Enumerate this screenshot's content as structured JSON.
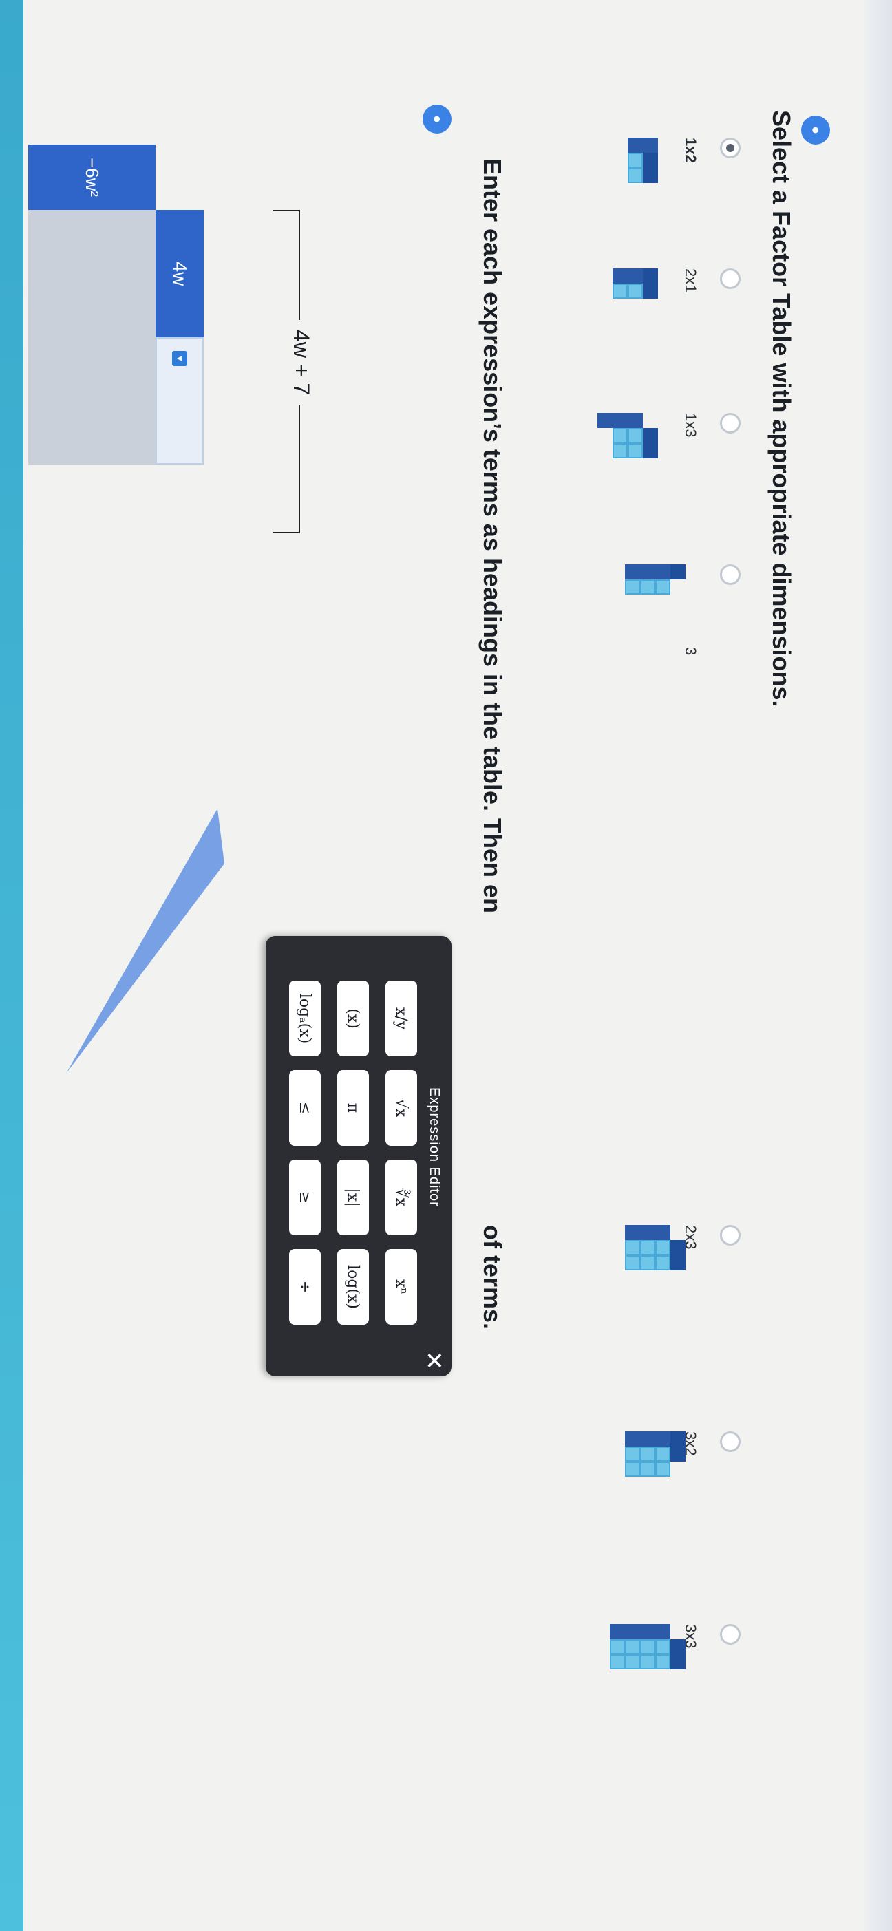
{
  "q1": {
    "number": "●",
    "title": "Select a Factor Table with appropriate dimensions.",
    "options": [
      {
        "label": "1x2",
        "selected": true
      },
      {
        "label": "2x1",
        "selected": false
      },
      {
        "label": "1x3",
        "selected": false
      },
      {
        "label": "3",
        "selected": false
      },
      {
        "label": "2x3",
        "selected": false
      },
      {
        "label": "3x2",
        "selected": false
      },
      {
        "label": "3x3",
        "selected": false
      }
    ]
  },
  "q2": {
    "number": "●",
    "title": "Enter each expression’s terms as headings in the table. Then en",
    "title_tail": "of terms.",
    "table": {
      "col_headers": [
        "4w",
        ""
      ],
      "row_headers": [
        "−6w²"
      ]
    },
    "expression_label": "4w + 7"
  },
  "editor": {
    "title": "Expression Editor",
    "close_icon": "✕",
    "keys": [
      [
        "x/y",
        "√x",
        "∛x",
        "xⁿ"
      ],
      [
        "(x)",
        "π",
        "|x|",
        "log(x)"
      ],
      [
        "logₐ(x)",
        "≤",
        "≥",
        "÷"
      ]
    ]
  },
  "colors": {
    "accent": "#2f64c8",
    "tile_light": "#6fc6e8",
    "tile_dark": "#2a5aa8",
    "editor_bg": "#2b2d33"
  }
}
